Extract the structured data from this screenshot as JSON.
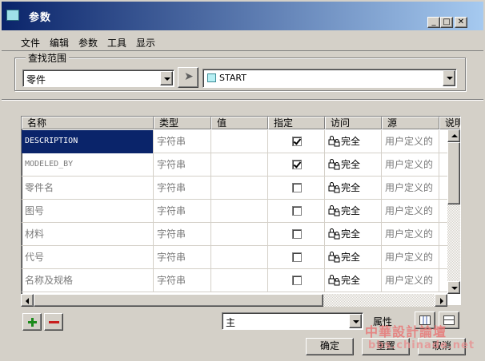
{
  "window": {
    "title": "参数"
  },
  "menu": [
    "文件",
    "编辑",
    "参数",
    "工具",
    "显示"
  ],
  "search": {
    "legend": "查找范围",
    "scope_value": "零件",
    "model_value": "START"
  },
  "table": {
    "columns": [
      "名称",
      "类型",
      "值",
      "指定",
      "访问",
      "源",
      "说明"
    ],
    "rows": [
      {
        "name": "DESCRIPTION",
        "type": "字符串",
        "value": "",
        "designated": true,
        "access": "完全",
        "source": "用户定义的",
        "selected": true
      },
      {
        "name": "MODELED_BY",
        "type": "字符串",
        "value": "",
        "designated": true,
        "access": "完全",
        "source": "用户定义的"
      },
      {
        "name": "零件名",
        "type": "字符串",
        "value": "",
        "designated": false,
        "access": "完全",
        "source": "用户定义的"
      },
      {
        "name": "图号",
        "type": "字符串",
        "value": "",
        "designated": false,
        "access": "完全",
        "source": "用户定义的"
      },
      {
        "name": "材料",
        "type": "字符串",
        "value": "",
        "designated": false,
        "access": "完全",
        "source": "用户定义的"
      },
      {
        "name": "代号",
        "type": "字符串",
        "value": "",
        "designated": false,
        "access": "完全",
        "source": "用户定义的"
      },
      {
        "name": "名称及规格",
        "type": "字符串",
        "value": "",
        "designated": false,
        "access": "完全",
        "source": "用户定义的"
      }
    ]
  },
  "bottom": {
    "filter_value": "主",
    "properties_label": "属性"
  },
  "buttons": {
    "ok": "确定",
    "reset": "重置",
    "cancel": "取消"
  },
  "watermark": {
    "line1": "中華設計論壇",
    "line2": "bbs.chinade.net"
  }
}
